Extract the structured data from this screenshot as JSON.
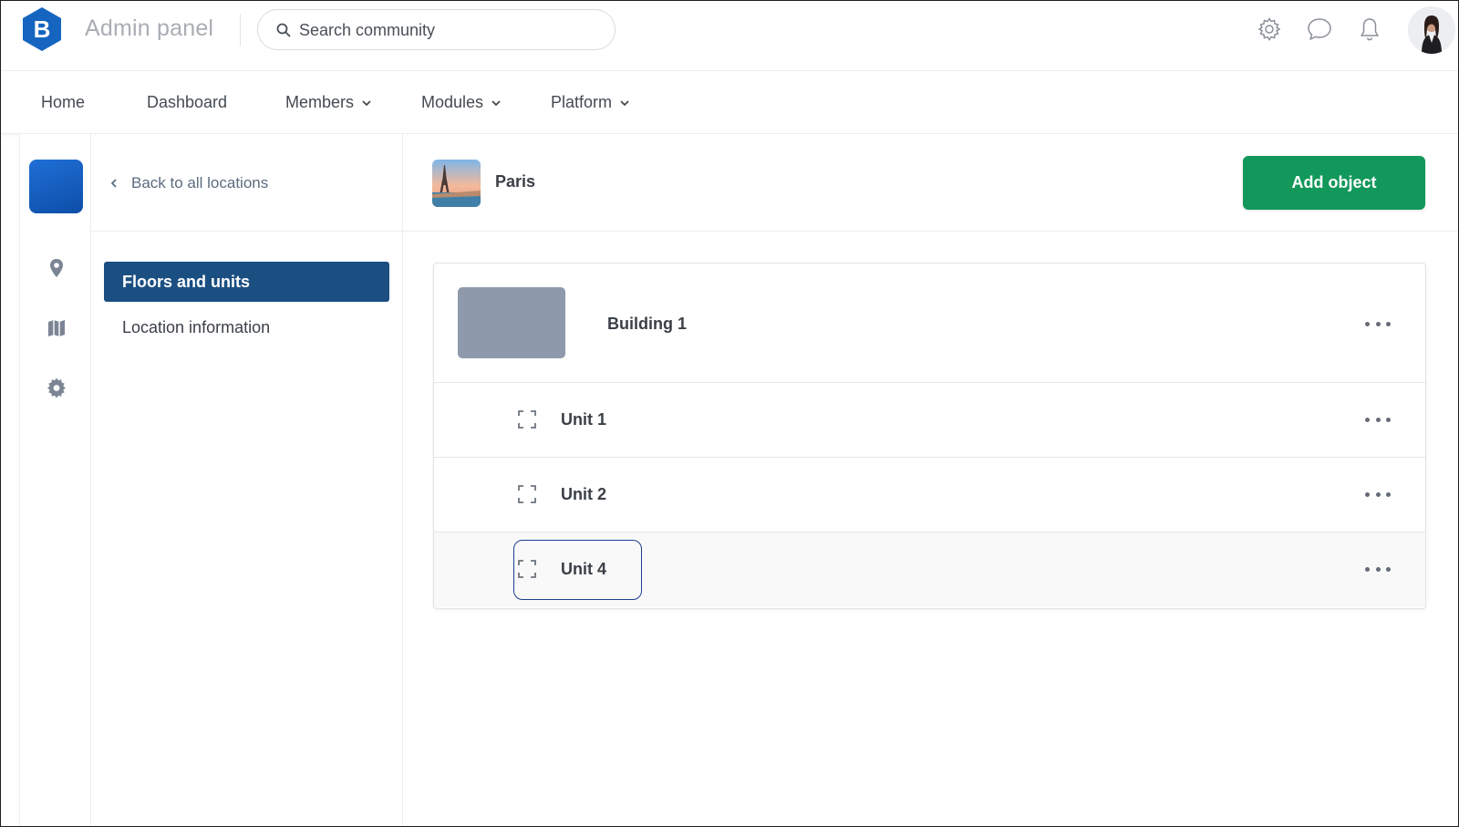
{
  "header": {
    "logo_letter": "B",
    "app_title": "Admin panel",
    "search": {
      "placeholder": "Search community",
      "icon": "search-icon"
    },
    "icons": [
      "settings-icon",
      "chat-icon",
      "bell-icon"
    ],
    "avatar": "user-avatar"
  },
  "nav": {
    "items": [
      {
        "label": "Home",
        "has_dropdown": false
      },
      {
        "label": "Dashboard",
        "has_dropdown": false
      },
      {
        "label": "Members",
        "has_dropdown": true
      },
      {
        "label": "Modules",
        "has_dropdown": true
      },
      {
        "label": "Platform",
        "has_dropdown": true
      }
    ]
  },
  "rail": {
    "icons": [
      "location-pin-icon",
      "map-icon",
      "gear-icon"
    ]
  },
  "subnav": {
    "back_label": "Back to all locations",
    "items": [
      {
        "label": "Floors and units",
        "active": true
      },
      {
        "label": "Location information",
        "active": false
      }
    ]
  },
  "location": {
    "name": "Paris",
    "add_button_label": "Add object"
  },
  "structure": {
    "building": {
      "name": "Building 1"
    },
    "units": [
      {
        "name": "Unit 1",
        "focused": false
      },
      {
        "name": "Unit 2",
        "focused": false
      },
      {
        "name": "Unit 4",
        "focused": true
      }
    ]
  },
  "colors": {
    "primary_nav_active": "#1b4f82",
    "add_button": "#12985a",
    "logo": "#1565c0",
    "focus_ring": "#1b3f8f"
  }
}
